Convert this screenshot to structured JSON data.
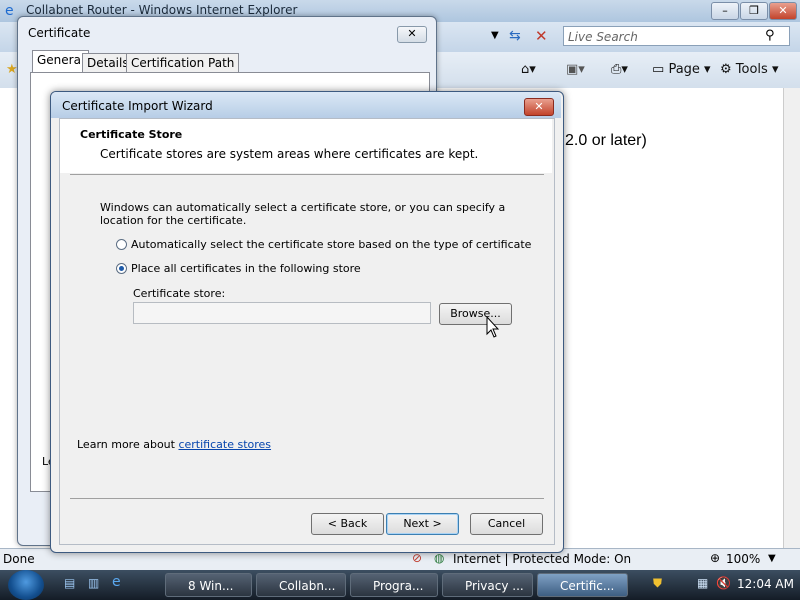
{
  "browser": {
    "title": "Collabnet Router - Windows Internet Explorer",
    "search_placeholder": "Live Search",
    "commands": {
      "page": "Page",
      "tools": "Tools"
    },
    "page_partial_text": "2.0 or later)",
    "status": {
      "left": "Done",
      "zone": "Internet | Protected Mode: On",
      "zoom": "100%"
    }
  },
  "certificate_dialog": {
    "title": "Certificate",
    "tabs": [
      "General",
      "Details",
      "Certification Path"
    ],
    "partial_text": "Le"
  },
  "wizard": {
    "title": "Certificate Import Wizard",
    "header_title": "Certificate Store",
    "header_desc": "Certificate stores are system areas where certificates are kept.",
    "intro": "Windows can automatically select a certificate store, or you can specify a location for the certificate.",
    "option_auto": "Automatically select the certificate store based on the type of certificate",
    "option_manual": "Place all certificates in the following store",
    "selected_option": "manual",
    "store_label": "Certificate store:",
    "store_value": "",
    "browse_label": "Browse...",
    "learn_prefix": "Learn more about ",
    "learn_link": "certificate stores",
    "back_label": "< Back",
    "next_label": "Next >",
    "cancel_label": "Cancel"
  },
  "taskbar": {
    "items": [
      "8 Win...",
      "Collabn...",
      "Progra...",
      "Privacy ...",
      "Certific..."
    ],
    "clock": "12:04 AM"
  }
}
